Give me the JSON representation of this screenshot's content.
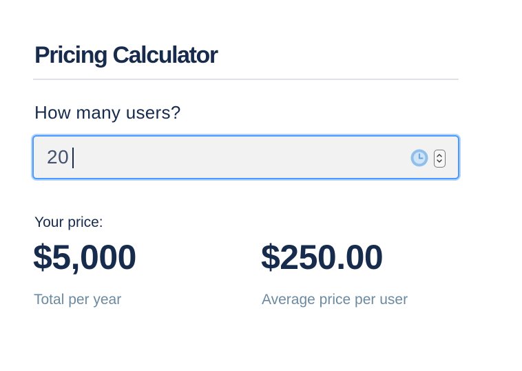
{
  "calculator": {
    "title": "Pricing Calculator",
    "question": "How many users?",
    "users_input": {
      "value": "20"
    },
    "price_label": "Your price:",
    "total": {
      "amount": "$5,000",
      "caption": "Total per year"
    },
    "average": {
      "amount": "$250.00",
      "caption": "Average price per user"
    }
  },
  "icons": {
    "clock": "clock-icon",
    "spinner": "number-spinner"
  },
  "colors": {
    "heading": "#172b4d",
    "caption": "#6b8aa1",
    "focus_border": "#4c9aff",
    "input_background": "#f2f2f2",
    "clock_icon": "#8fc0ec"
  }
}
